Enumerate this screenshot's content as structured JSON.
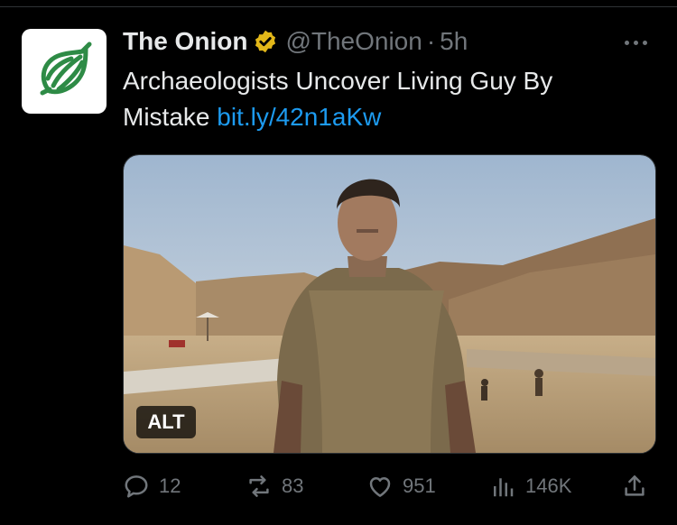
{
  "tweet": {
    "author_name": "The Onion",
    "handle": "@TheOnion",
    "separator": "·",
    "time": "5h",
    "text": "Archaeologists Uncover Living Guy By Mistake",
    "link": "bit.ly/42n1aKw",
    "media_alt_label": "ALT"
  },
  "actions": {
    "replies": "12",
    "reposts": "83",
    "likes": "951",
    "views": "146K"
  },
  "icons": {
    "avatar": "onion-logo-icon",
    "verified": "verified-badge-icon",
    "more": "more-icon",
    "reply": "reply-icon",
    "repost": "repost-icon",
    "like": "heart-icon",
    "views": "views-icon",
    "share": "share-icon"
  },
  "colors": {
    "background": "#000000",
    "link": "#1d9bf0",
    "muted": "#71767b",
    "badge": "#e2b719",
    "onion_green": "#2e8b46"
  }
}
